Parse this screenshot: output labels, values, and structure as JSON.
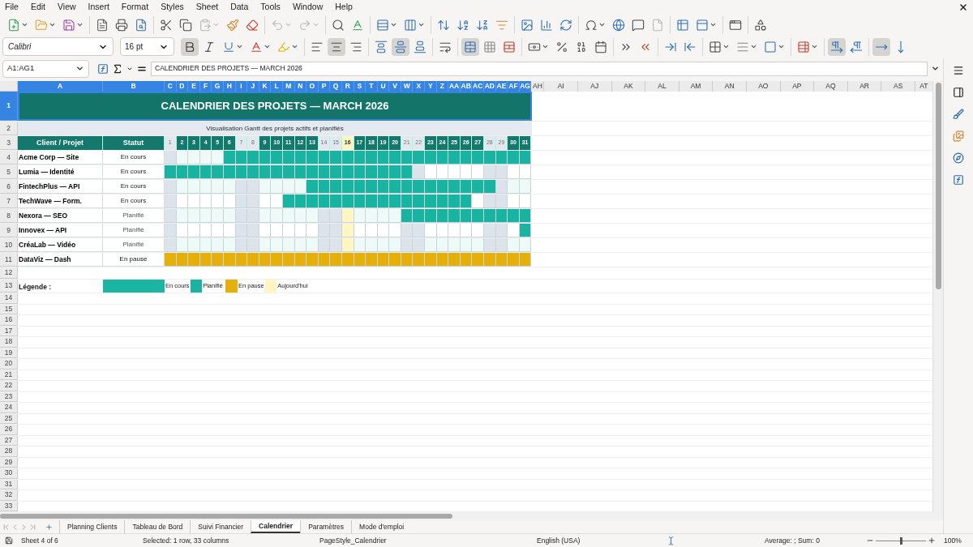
{
  "menu": [
    "File",
    "Edit",
    "View",
    "Insert",
    "Format",
    "Styles",
    "Sheet",
    "Data",
    "Tools",
    "Window",
    "Help"
  ],
  "toolbar_standard": [
    [
      {
        "dropdown": true,
        "disabled": false
      },
      {
        "dropdown": true,
        "disabled": false
      },
      {
        "dropdown": true,
        "disabled": false
      }
    ],
    [
      {
        "dropdown": false,
        "disabled": false
      },
      {
        "dropdown": false,
        "disabled": false
      },
      {
        "dropdown": false,
        "disabled": false
      }
    ],
    [
      {
        "dropdown": false,
        "disabled": false
      },
      {
        "dropdown": false,
        "disabled": false
      },
      {
        "dropdown": true,
        "disabled": true
      },
      {
        "dropdown": false,
        "disabled": false
      },
      {
        "dropdown": false,
        "disabled": false
      }
    ],
    [
      {
        "dropdown": true,
        "disabled": true
      },
      {
        "dropdown": true,
        "disabled": true
      }
    ],
    [
      {
        "dropdown": false,
        "disabled": false
      },
      {
        "dropdown": false,
        "disabled": false
      }
    ],
    [
      {
        "dropdown": true,
        "disabled": false
      },
      {
        "dropdown": true,
        "disabled": false
      }
    ],
    [
      {
        "dropdown": false,
        "disabled": false
      },
      {
        "dropdown": false,
        "disabled": false
      },
      {
        "dropdown": false,
        "disabled": false
      },
      {
        "dropdown": false,
        "disabled": false
      }
    ],
    [
      {
        "dropdown": false,
        "disabled": false
      },
      {
        "dropdown": false,
        "disabled": false
      },
      {
        "dropdown": false,
        "disabled": false
      }
    ],
    [
      {
        "dropdown": true,
        "disabled": false
      },
      {
        "dropdown": false,
        "disabled": false
      },
      {
        "dropdown": false,
        "disabled": false
      },
      {
        "dropdown": false,
        "disabled": true
      }
    ],
    [
      {
        "dropdown": false,
        "disabled": false
      },
      {
        "dropdown": true,
        "disabled": false
      }
    ],
    [
      {
        "dropdown": false,
        "disabled": false
      }
    ],
    [
      {
        "dropdown": false,
        "disabled": false
      }
    ]
  ],
  "font_name": "Calibri",
  "font_size": "16 pt",
  "toolbar_formatting": [
    [
      {
        "dropdown": false,
        "active": true
      },
      {
        "dropdown": false,
        "active": false
      },
      {
        "dropdown": true,
        "active": false
      },
      {
        "dropdown": true,
        "active": false
      },
      {
        "dropdown": true,
        "active": false
      }
    ],
    [
      {
        "dropdown": false,
        "active": false
      },
      {
        "dropdown": false,
        "active": true
      },
      {
        "dropdown": false,
        "active": false
      }
    ],
    [
      {
        "dropdown": false,
        "active": false
      },
      {
        "dropdown": false,
        "active": true
      },
      {
        "dropdown": false,
        "active": false
      }
    ],
    [
      {
        "dropdown": false,
        "active": false
      }
    ],
    [
      {
        "dropdown": false,
        "active": true
      },
      {
        "dropdown": false,
        "active": false
      },
      {
        "dropdown": false,
        "active": false
      }
    ],
    [
      {
        "dropdown": true,
        "active": false
      },
      {
        "dropdown": false,
        "active": false
      },
      {
        "dropdown": false,
        "active": false
      },
      {
        "dropdown": false,
        "active": false
      }
    ],
    [
      {
        "dropdown": false,
        "active": false
      },
      {
        "dropdown": false,
        "active": false
      }
    ],
    [
      {
        "dropdown": false,
        "active": false
      },
      {
        "dropdown": false,
        "active": false
      }
    ],
    [
      {
        "dropdown": true,
        "active": false
      },
      {
        "dropdown": true,
        "active": false
      },
      {
        "dropdown": true,
        "active": false
      }
    ],
    [
      {
        "dropdown": true,
        "active": false
      }
    ],
    [
      {
        "dropdown": false,
        "active": true
      },
      {
        "dropdown": false,
        "active": false
      }
    ],
    [
      {
        "dropdown": false,
        "active": true
      },
      {
        "dropdown": false,
        "active": false
      }
    ]
  ],
  "name_box": "A1:AG1",
  "formula": "CALENDRIER DES PROJETS — MARCH 2026",
  "columns": [
    {
      "label": "A",
      "selected": true
    },
    {
      "label": "B",
      "selected": true
    },
    {
      "label": "C",
      "selected": true
    },
    {
      "label": "D",
      "selected": true
    },
    {
      "label": "E",
      "selected": true
    },
    {
      "label": "F",
      "selected": true
    },
    {
      "label": "G",
      "selected": true
    },
    {
      "label": "H",
      "selected": true
    },
    {
      "label": "I",
      "selected": true
    },
    {
      "label": "J",
      "selected": true
    },
    {
      "label": "K",
      "selected": true
    },
    {
      "label": "L",
      "selected": true
    },
    {
      "label": "M",
      "selected": true
    },
    {
      "label": "N",
      "selected": true
    },
    {
      "label": "O",
      "selected": true
    },
    {
      "label": "P",
      "selected": true
    },
    {
      "label": "Q",
      "selected": true
    },
    {
      "label": "R",
      "selected": true
    },
    {
      "label": "S",
      "selected": true
    },
    {
      "label": "T",
      "selected": true
    },
    {
      "label": "U",
      "selected": true
    },
    {
      "label": "V",
      "selected": true
    },
    {
      "label": "W",
      "selected": true
    },
    {
      "label": "X",
      "selected": true
    },
    {
      "label": "Y",
      "selected": true
    },
    {
      "label": "Z",
      "selected": true
    },
    {
      "label": "AA",
      "selected": true
    },
    {
      "label": "AB",
      "selected": true
    },
    {
      "label": "AC",
      "selected": true
    },
    {
      "label": "AD",
      "selected": true
    },
    {
      "label": "AE",
      "selected": true
    },
    {
      "label": "AF",
      "selected": true
    },
    {
      "label": "AG",
      "selected": true
    },
    {
      "label": "AH",
      "selected": false
    },
    {
      "label": "AI",
      "selected": false
    },
    {
      "label": "AJ",
      "selected": false
    },
    {
      "label": "AK",
      "selected": false
    },
    {
      "label": "AL",
      "selected": false
    },
    {
      "label": "AM",
      "selected": false
    },
    {
      "label": "AN",
      "selected": false
    },
    {
      "label": "AO",
      "selected": false
    },
    {
      "label": "AP",
      "selected": false
    },
    {
      "label": "AQ",
      "selected": false
    },
    {
      "label": "AR",
      "selected": false
    },
    {
      "label": "AS",
      "selected": false
    },
    {
      "label": "AT",
      "selected": false
    }
  ],
  "row_headers": [
    {
      "label": "1",
      "selected": true
    },
    {
      "label": "2",
      "selected": false
    },
    {
      "label": "3",
      "selected": false
    },
    {
      "label": "4",
      "selected": false
    },
    {
      "label": "5",
      "selected": false
    },
    {
      "label": "6",
      "selected": false
    },
    {
      "label": "7",
      "selected": false
    },
    {
      "label": "8",
      "selected": false
    },
    {
      "label": "9",
      "selected": false
    },
    {
      "label": "10",
      "selected": false
    },
    {
      "label": "11",
      "selected": false
    },
    {
      "label": "12",
      "selected": false
    },
    {
      "label": "13",
      "selected": false
    },
    {
      "label": "14",
      "selected": false
    },
    {
      "label": "15",
      "selected": false
    },
    {
      "label": "16",
      "selected": false
    },
    {
      "label": "17",
      "selected": false
    },
    {
      "label": "18",
      "selected": false
    },
    {
      "label": "19",
      "selected": false
    },
    {
      "label": "20",
      "selected": false
    },
    {
      "label": "21",
      "selected": false
    },
    {
      "label": "22",
      "selected": false
    },
    {
      "label": "23",
      "selected": false
    },
    {
      "label": "24",
      "selected": false
    },
    {
      "label": "25",
      "selected": false
    },
    {
      "label": "26",
      "selected": false
    },
    {
      "label": "27",
      "selected": false
    },
    {
      "label": "28",
      "selected": false
    },
    {
      "label": "29",
      "selected": false
    },
    {
      "label": "30",
      "selected": false
    },
    {
      "label": "31",
      "selected": false
    },
    {
      "label": "32",
      "selected": false
    },
    {
      "label": "33",
      "selected": false
    }
  ],
  "sheet": {
    "title": "CALENDRIER DES PROJETS — MARCH 2026",
    "subtitle": "Visualisation Gantt des projets actifs et planifiés",
    "header_client": "Client / Projet",
    "header_status": "Statut",
    "days": [
      {
        "label": "1",
        "kind": "weekend"
      },
      {
        "label": "2",
        "kind": "weekday"
      },
      {
        "label": "3",
        "kind": "weekday"
      },
      {
        "label": "4",
        "kind": "weekday"
      },
      {
        "label": "5",
        "kind": "weekday"
      },
      {
        "label": "6",
        "kind": "weekday"
      },
      {
        "label": "7",
        "kind": "weekend"
      },
      {
        "label": "8",
        "kind": "weekend"
      },
      {
        "label": "9",
        "kind": "weekday"
      },
      {
        "label": "10",
        "kind": "weekday"
      },
      {
        "label": "11",
        "kind": "weekday"
      },
      {
        "label": "12",
        "kind": "weekday"
      },
      {
        "label": "13",
        "kind": "weekday"
      },
      {
        "label": "14",
        "kind": "weekend"
      },
      {
        "label": "15",
        "kind": "weekend"
      },
      {
        "label": "16",
        "kind": "today"
      },
      {
        "label": "17",
        "kind": "weekday"
      },
      {
        "label": "18",
        "kind": "weekday"
      },
      {
        "label": "19",
        "kind": "weekday"
      },
      {
        "label": "20",
        "kind": "weekday"
      },
      {
        "label": "21",
        "kind": "weekend"
      },
      {
        "label": "22",
        "kind": "weekend"
      },
      {
        "label": "23",
        "kind": "weekday"
      },
      {
        "label": "24",
        "kind": "weekday"
      },
      {
        "label": "25",
        "kind": "weekday"
      },
      {
        "label": "26",
        "kind": "weekday"
      },
      {
        "label": "27",
        "kind": "weekday"
      },
      {
        "label": "28",
        "kind": "weekend"
      },
      {
        "label": "29",
        "kind": "weekend"
      },
      {
        "label": "30",
        "kind": "weekday"
      },
      {
        "label": "31",
        "kind": "weekday"
      }
    ],
    "projects": [
      {
        "name": "Acme Corp — Site",
        "status": "En cours",
        "kind": "active",
        "filled": [
          false,
          false,
          false,
          false,
          false,
          true,
          true,
          true,
          true,
          true,
          true,
          true,
          true,
          true,
          true,
          true,
          true,
          true,
          true,
          true,
          true,
          true,
          true,
          true,
          true,
          true,
          true,
          true,
          true,
          true,
          true
        ]
      },
      {
        "name": "Lumia — Identité",
        "status": "En cours",
        "kind": "active",
        "filled": [
          true,
          true,
          true,
          true,
          true,
          true,
          true,
          true,
          true,
          true,
          true,
          true,
          true,
          true,
          true,
          true,
          true,
          true,
          true,
          true,
          true,
          false,
          false,
          false,
          false,
          false,
          false,
          false,
          false,
          false,
          false
        ]
      },
      {
        "name": "FintechPlus — API",
        "status": "En cours",
        "kind": "active",
        "filled": [
          false,
          false,
          false,
          false,
          false,
          false,
          false,
          false,
          false,
          false,
          false,
          false,
          true,
          true,
          true,
          true,
          true,
          true,
          true,
          true,
          true,
          true,
          true,
          true,
          true,
          true,
          true,
          true,
          false,
          false,
          false
        ]
      },
      {
        "name": "TechWave — Form.",
        "status": "En cours",
        "kind": "active",
        "filled": [
          false,
          false,
          false,
          false,
          false,
          false,
          false,
          false,
          false,
          false,
          true,
          true,
          true,
          true,
          true,
          true,
          true,
          true,
          true,
          true,
          true,
          true,
          true,
          true,
          true,
          true,
          false,
          false,
          false,
          false,
          false
        ]
      },
      {
        "name": "Nexora — SEO",
        "status": "Planifié",
        "kind": "planned",
        "filled": [
          false,
          false,
          false,
          false,
          false,
          false,
          false,
          false,
          false,
          false,
          false,
          false,
          false,
          false,
          false,
          false,
          false,
          false,
          false,
          false,
          true,
          true,
          true,
          true,
          true,
          true,
          true,
          true,
          true,
          true,
          true
        ]
      },
      {
        "name": "Innovex — API",
        "status": "Planifié",
        "kind": "planned",
        "filled": [
          false,
          false,
          false,
          false,
          false,
          false,
          false,
          false,
          false,
          false,
          false,
          false,
          false,
          false,
          false,
          false,
          false,
          false,
          false,
          false,
          false,
          false,
          false,
          false,
          false,
          false,
          false,
          false,
          false,
          false,
          true
        ]
      },
      {
        "name": "CréaLab — Vidéo",
        "status": "Planifié",
        "kind": "planned",
        "filled": [
          false,
          false,
          false,
          false,
          false,
          false,
          false,
          false,
          false,
          false,
          false,
          false,
          false,
          false,
          false,
          false,
          false,
          false,
          false,
          false,
          false,
          false,
          false,
          false,
          false,
          false,
          false,
          false,
          false,
          false,
          false
        ]
      },
      {
        "name": "DataViz — Dash",
        "status": "En pause",
        "kind": "paused",
        "filled": [
          true,
          true,
          true,
          true,
          true,
          true,
          true,
          true,
          true,
          true,
          true,
          true,
          true,
          true,
          true,
          true,
          true,
          true,
          true,
          true,
          true,
          true,
          true,
          true,
          true,
          true,
          true,
          true,
          true,
          true,
          true
        ]
      }
    ],
    "legend_label": "Légende :",
    "legend": [
      {
        "label": "En cours",
        "color": "#1ab5a3"
      },
      {
        "label": "Planifié",
        "color": "#19b3a1"
      },
      {
        "label": "En pause",
        "color": "#e6b00a"
      },
      {
        "label": "Aujourd'hui",
        "color": "#fff6c4"
      }
    ]
  },
  "sheet_tabs": [
    {
      "label": "Planning Clients",
      "selected": false
    },
    {
      "label": "Tableau de Bord",
      "selected": false
    },
    {
      "label": "Suivi Financier",
      "selected": false
    },
    {
      "label": "Calendrier",
      "selected": true
    },
    {
      "label": "Paramètres",
      "selected": false
    },
    {
      "label": "Mode d'emploi",
      "selected": false
    }
  ],
  "status_bar": {
    "sheet": "Sheet 4 of 6",
    "selection": "Selected: 1 row, 33 columns",
    "page_style": "PageStyle_Calendrier",
    "language": "English (USA)",
    "sum": "Average: ; Sum: 0",
    "zoom": {
      "level": 0.5
    },
    "zoom_text": "100%"
  }
}
